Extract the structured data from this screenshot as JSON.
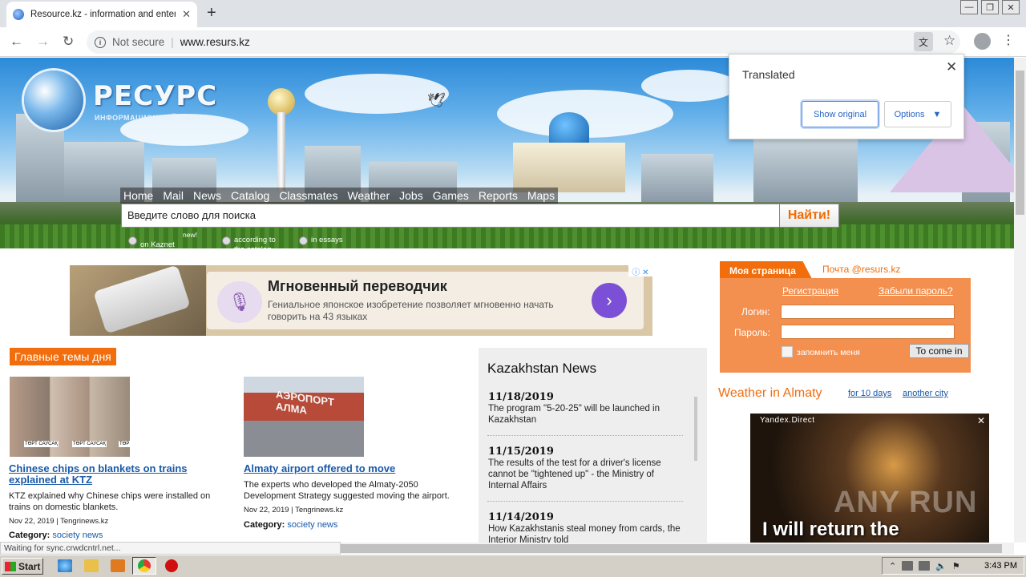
{
  "browser": {
    "tab_title": "Resource.kz - information and entertainment portal",
    "new_tab": "+",
    "not_secure": "Not secure",
    "url": "www.resurs.kz",
    "window_controls": [
      "—",
      "❐",
      "✕"
    ]
  },
  "translate_popup": {
    "title": "Translated",
    "show_original": "Show original",
    "options": "Options"
  },
  "site": {
    "logo": "РЕСУРС",
    "logo_sub": "ИНФОРМАЦИОННЫЙ ПОРТАЛ",
    "nav": [
      "Home",
      "Mail",
      "News",
      "Catalog",
      "Classmates",
      "Weather",
      "Jobs",
      "Games",
      "Reports",
      "Maps"
    ],
    "search_placeholder": "Введите слово для поиска",
    "search_button": "Найти!",
    "radio_new": "new!",
    "radio_options": [
      "on Kaznet",
      "according to the catalog",
      "in essays"
    ]
  },
  "ad": {
    "headline": "Мгновенный переводчик",
    "text": "Гениальное японское изобретение позволяет мгновенно начать говорить на 43 языках",
    "badge": "ⓘ ✕"
  },
  "main_topics": {
    "heading": "Главные темы дня",
    "stories": [
      {
        "title": "Chinese chips on blankets on trains explained at KTZ",
        "desc": "KTZ explained why Chinese chips were installed on trains on domestic blankets.",
        "meta": "Nov 22, 2019 | Tengrinews.kz",
        "category_label": "Category:",
        "category": "society news",
        "image_labels": [
          "ТӨРТ САУСАҚ",
          "ТӨРТ САУСАҚ",
          "ТӨР"
        ]
      },
      {
        "title": "Almaty airport offered to move",
        "desc": "The experts who developed the Almaty-2050 Development Strategy suggested moving the airport.",
        "meta": "Nov 22, 2019 | Tengrinews.kz",
        "category_label": "Category:",
        "category": "society news",
        "image_sign": "АЭРОПОРТ АЛМА"
      }
    ]
  },
  "kz_news": {
    "heading": "Kazakhstan News",
    "items": [
      {
        "date": "11/18/2019",
        "text": "The program \"5-20-25\" will be launched in Kazakhstan"
      },
      {
        "date": "11/15/2019",
        "text": "The results of the test for a driver's license cannot be \"tightened up\" - the Ministry of Internal Affairs"
      },
      {
        "date": "11/14/2019",
        "text": "How Kazakhstanis steal money from cards, the Interior Ministry told"
      }
    ]
  },
  "sidebar": {
    "my_page": "Моя страница",
    "mail": "Почта @resurs.kz",
    "register": "Регистрация",
    "forgot": "Забыли пароль?",
    "login_label": "Логин:",
    "password_label": "Пароль:",
    "remember": "запомнить меня",
    "login_button": "To come in",
    "weather_title": "Weather in Almaty",
    "weather_10days": "for 10 days",
    "weather_city": "another city"
  },
  "yandex_ad": {
    "label": "Yandex.Direct",
    "close": "✕",
    "caption": "I will return the"
  },
  "watermark": "ANY RUN",
  "status_bar": "Waiting for sync.crwdcntrl.net...",
  "taskbar": {
    "start": "Start",
    "clock": "3:43 PM"
  },
  "colors": {
    "accent_orange": "#f26d0c",
    "link_blue": "#1a5aa8"
  }
}
